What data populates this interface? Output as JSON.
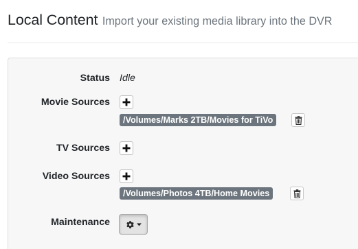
{
  "header": {
    "title": "Local Content",
    "subtitle": "Import your existing media library into the DVR"
  },
  "status": {
    "label": "Status",
    "value": "Idle"
  },
  "movie_sources": {
    "label": "Movie Sources",
    "paths": [
      "/Volumes/Marks 2TB/Movies for TiVo"
    ],
    "add_icon": "plus-icon",
    "remove_icon": "trash-icon"
  },
  "tv_sources": {
    "label": "TV Sources",
    "paths": [],
    "add_icon": "plus-icon"
  },
  "video_sources": {
    "label": "Video Sources",
    "paths": [
      "/Volumes/Photos 4TB/Home Movies"
    ],
    "add_icon": "plus-icon",
    "remove_icon": "trash-icon"
  },
  "maintenance": {
    "label": "Maintenance",
    "menu_icon": "gear-icon",
    "caret_icon": "caret-down-icon"
  },
  "colors": {
    "badge": "#6c757d",
    "panel": "#f7f7f7",
    "muted_text": "#6c757d"
  }
}
